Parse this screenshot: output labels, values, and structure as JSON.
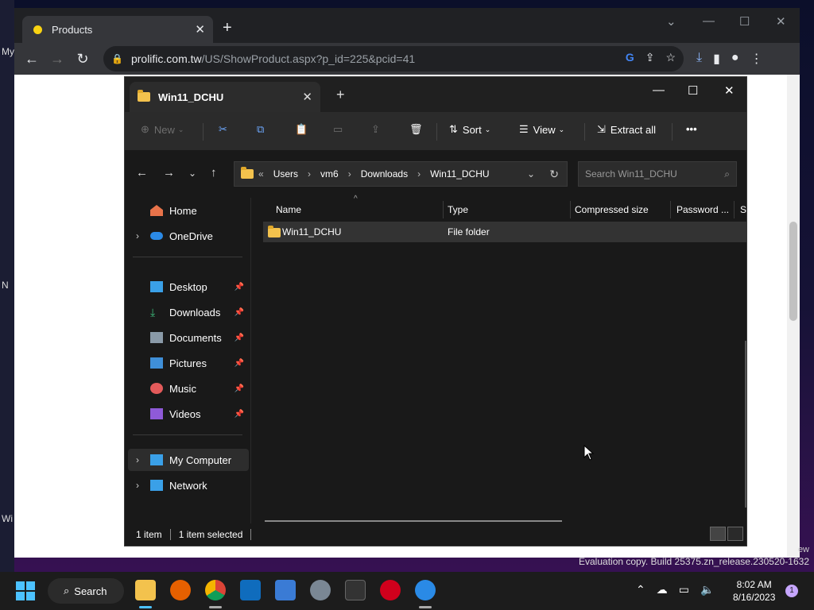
{
  "desktop": {
    "fragments": [
      "My",
      "N",
      "Wi"
    ],
    "eval_frag": "ew"
  },
  "browser": {
    "tab_title": "Products",
    "url_host": "prolific.com.tw",
    "url_path": "/US/ShowProduct.aspx?p_id=225&pcid=41"
  },
  "explorer": {
    "tab_title": "Win11_DCHU",
    "commands": {
      "new": "New",
      "sort": "Sort",
      "view": "View",
      "extract_all": "Extract all"
    },
    "breadcrumb": [
      "Users",
      "vm6",
      "Downloads",
      "Win11_DCHU"
    ],
    "search_placeholder": "Search Win11_DCHU",
    "nav": {
      "home": "Home",
      "onedrive": "OneDrive",
      "desktop": "Desktop",
      "downloads": "Downloads",
      "documents": "Documents",
      "pictures": "Pictures",
      "music": "Music",
      "videos": "Videos",
      "my_computer": "My Computer",
      "network": "Network"
    },
    "columns": [
      "Name",
      "Type",
      "Compressed size",
      "Password ...",
      "Si"
    ],
    "rows": [
      {
        "name": "Win11_DCHU",
        "type": "File folder"
      }
    ],
    "status": {
      "count": "1 item",
      "selected": "1 item selected"
    }
  },
  "evaluation": "Evaluation copy. Build 25375.zn_release.230520-1632",
  "taskbar": {
    "search": "Search",
    "time": "8:02 AM",
    "date": "8/16/2023",
    "notifications": "1"
  }
}
